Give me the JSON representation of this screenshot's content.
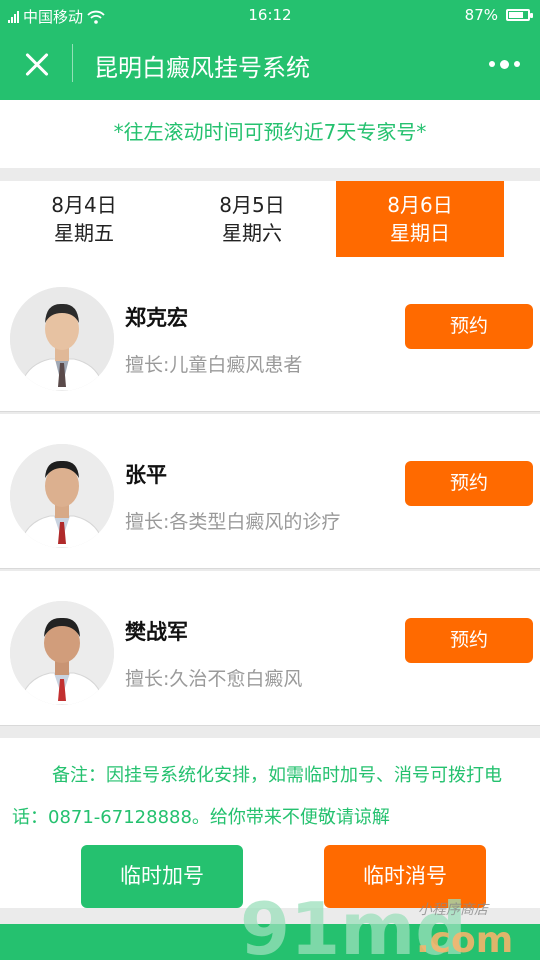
{
  "status_bar": {
    "carrier": "中国移动",
    "time": "16:12",
    "battery": "87%",
    "battery_level": 0.87
  },
  "header": {
    "title": "昆明白癜风挂号系统"
  },
  "notice": "*往左滚动时间可预约近7天专家号*",
  "dates": [
    {
      "date": "8月4日",
      "weekday": "星期五",
      "active": false
    },
    {
      "date": "8月5日",
      "weekday": "星期六",
      "active": false
    },
    {
      "date": "8月6日",
      "weekday": "星期日",
      "active": true
    }
  ],
  "doctors": [
    {
      "name": "郑克宏",
      "skill": "擅长:儿童白癜风患者",
      "button": "预约"
    },
    {
      "name": "张平",
      "skill": "擅长:各类型白癜风的诊疗",
      "button": "预约"
    },
    {
      "name": "樊战军",
      "skill": "擅长:久治不愈白癜风",
      "button": "预约"
    }
  ],
  "footer": {
    "note": "备注：因挂号系统化安排，如需临时加号、消号可拨打电话：0871-67128888。给你带来不便敬请谅解",
    "add_button": "临时加号",
    "cancel_button": "临时消号"
  },
  "watermark": {
    "logo": "91md.com",
    "tagline": "小程序商店"
  },
  "colors": {
    "primary": "#25c16f",
    "accent": "#ff6a00"
  }
}
